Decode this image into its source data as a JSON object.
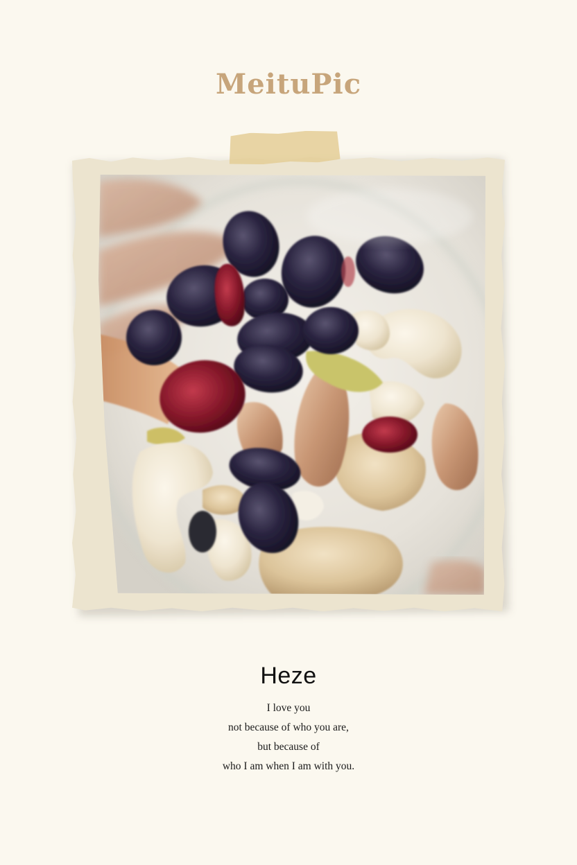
{
  "brand": {
    "logo_text": "MeituPic",
    "color": "#c7a57b"
  },
  "photo": {
    "subject_icon": "mixed-nuts-and-dried-fruit-photo",
    "tape_icon": "masking-tape-icon"
  },
  "caption": {
    "title": "Heze",
    "lines": [
      "I love you",
      "not because of who you are,",
      "but because of",
      "who I am when I am with you."
    ]
  }
}
